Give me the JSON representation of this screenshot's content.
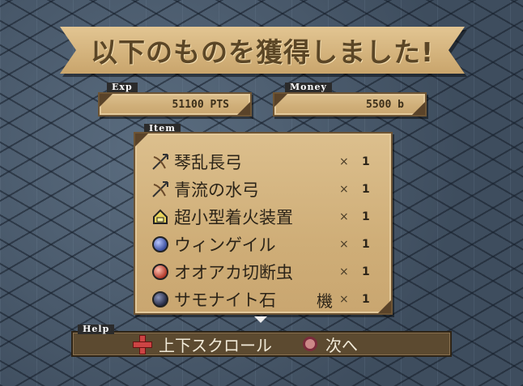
{
  "banner": {
    "title": "以下のものを獲得しました!"
  },
  "exp": {
    "label": "Exp",
    "value": "51100 PTS"
  },
  "money": {
    "label": "Money",
    "value": "5500 b"
  },
  "items": {
    "label": "Item",
    "list": [
      {
        "icon": "bow-icon",
        "name": "琴乱長弓",
        "x": "×",
        "qty": "1"
      },
      {
        "icon": "bow-icon",
        "name": "青流の水弓",
        "x": "×",
        "qty": "1"
      },
      {
        "icon": "device-icon",
        "name": "超小型着火装置",
        "x": "×",
        "qty": "1"
      },
      {
        "icon": "blue-gem-icon",
        "name": "ウィンゲイル",
        "x": "×",
        "qty": "1"
      },
      {
        "icon": "red-gem-icon",
        "name": "オオアカ切断虫",
        "x": "×",
        "qty": "1"
      },
      {
        "icon": "dark-gem-icon",
        "name": "サモナイト石",
        "extra": "機",
        "x": "×",
        "qty": "1"
      }
    ]
  },
  "help": {
    "label": "Help",
    "scroll_text": "上下スクロール",
    "next_text": "次へ"
  }
}
